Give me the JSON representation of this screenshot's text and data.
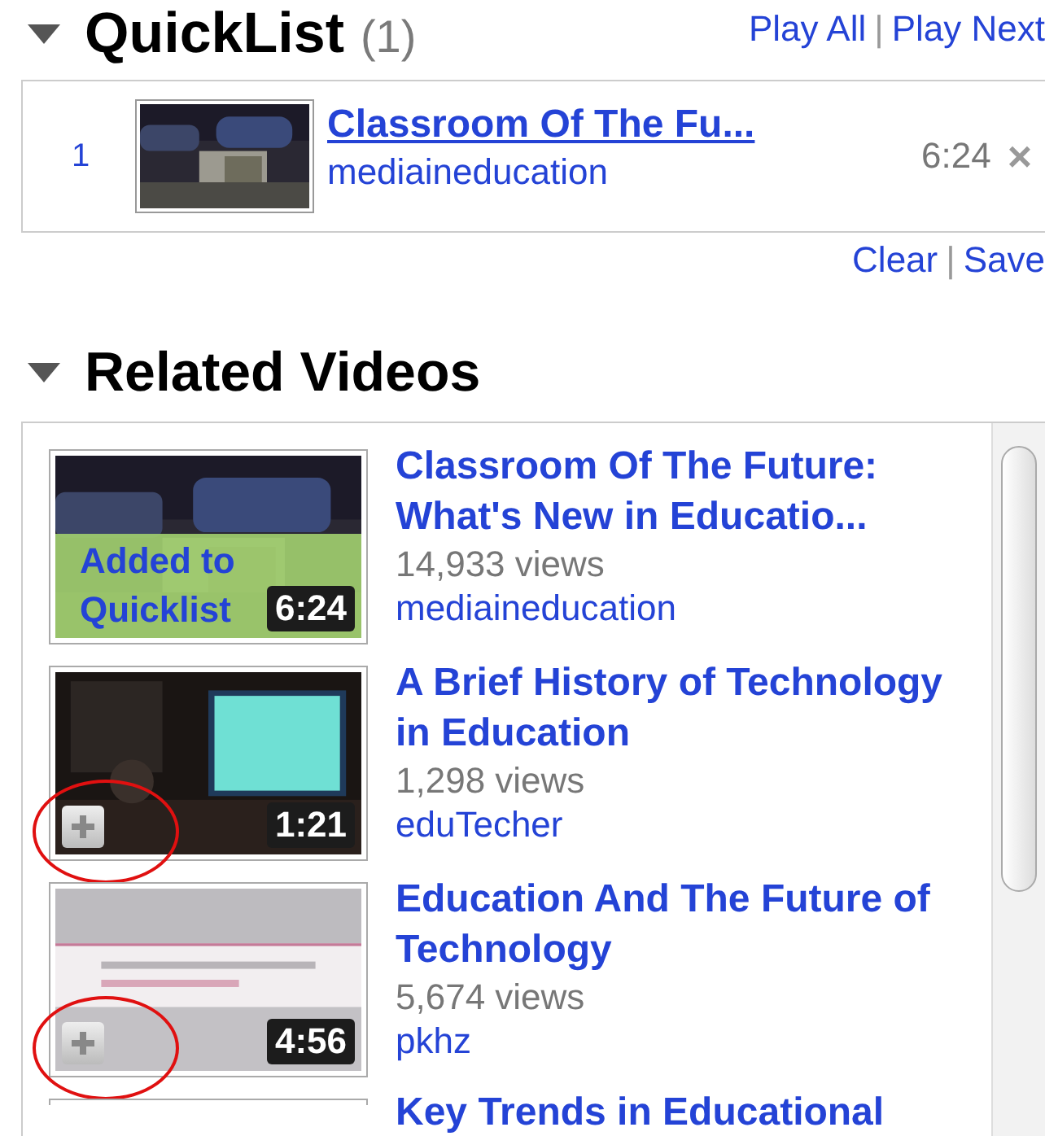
{
  "quicklist": {
    "title": "QuickList",
    "count": "(1)",
    "expanded": true,
    "actions": [
      "Play All",
      "Play Next"
    ],
    "separator": "|",
    "items": [
      {
        "number": "1",
        "title": "Classroom Of The Fu...",
        "channel": "mediaineducation",
        "duration": "6:24",
        "remove": "×"
      }
    ],
    "footer_actions": [
      "Clear",
      "Save"
    ]
  },
  "related": {
    "title": "Related Videos",
    "expanded": true,
    "videos": [
      {
        "title": "Classroom Of The Future: What's New in Educatio...",
        "views": "14,933 views",
        "channel": "mediaineducation",
        "duration": "6:24",
        "added": true,
        "added_label": "Added to Quicklist",
        "circled": false
      },
      {
        "title": "A Brief History of Technology in Education",
        "views": "1,298 views",
        "channel": "eduTecher",
        "duration": "1:21",
        "added": false,
        "circled": true
      },
      {
        "title": "Education And The Future of Technology",
        "views": "5,674 views",
        "channel": "pkhz",
        "duration": "4:56",
        "added": false,
        "circled": true
      },
      {
        "title": "Key Trends in Educational"
      }
    ]
  }
}
